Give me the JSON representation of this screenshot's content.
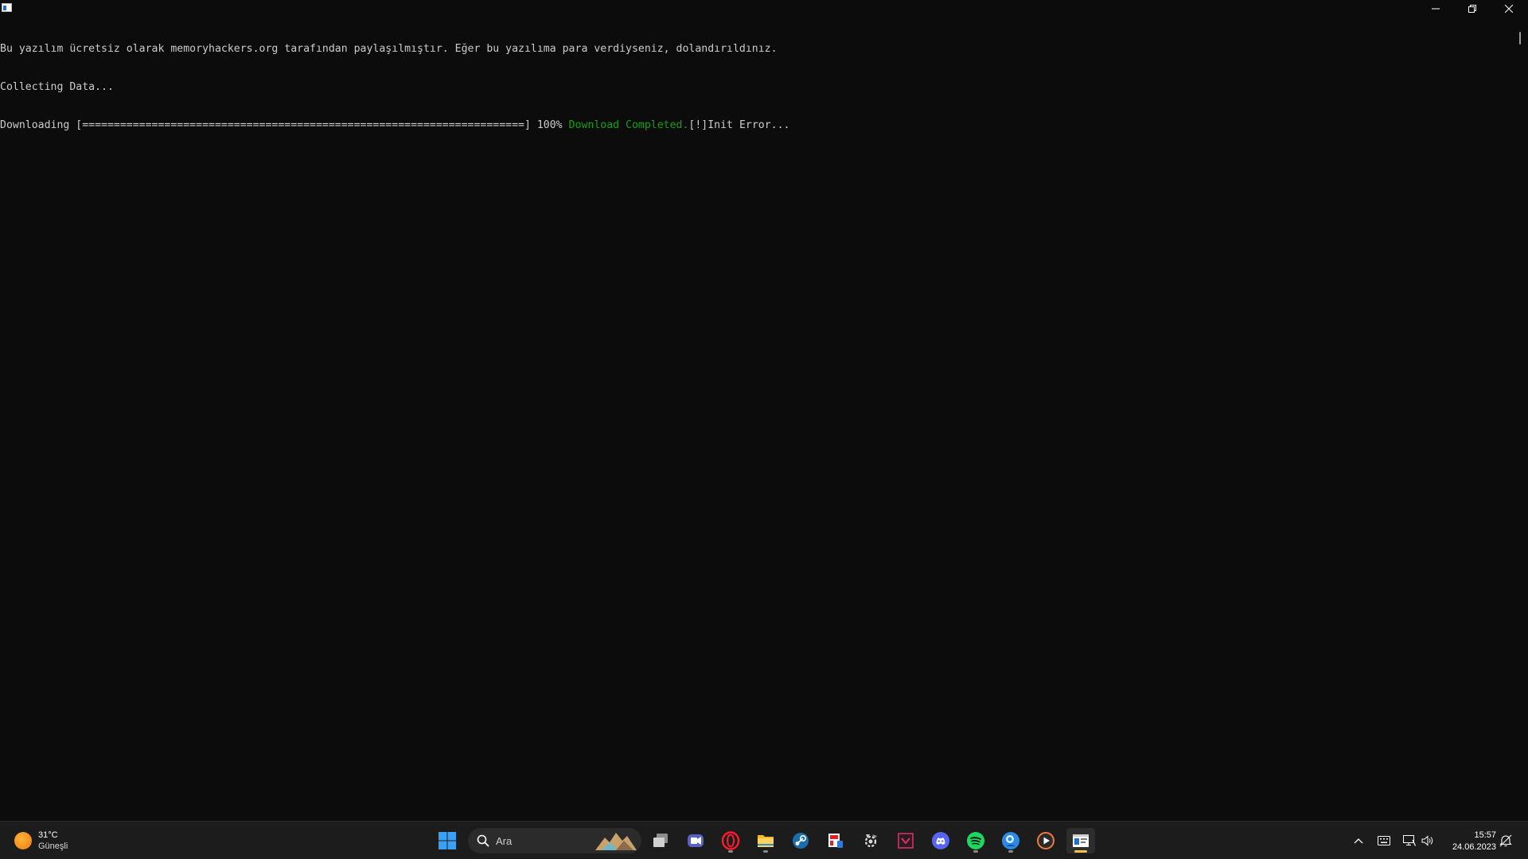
{
  "console": {
    "line1": "Bu yazılım ücretsiz olarak memoryhackers.org tarafından paylaşılmıştır. Eğer bu yazılıma para verdiyseniz, dolandırıldınız.",
    "line2": "Collecting Data...",
    "line3_prefix": "Downloading [======================================================================] 100% ",
    "line3_success": "Download Completed.",
    "line3_error": "[!]Init Error..."
  },
  "progress": {
    "percent": 100
  },
  "weather": {
    "temperature": "31°C",
    "condition": "Güneşli"
  },
  "search": {
    "placeholder": "Ara"
  },
  "taskbar_apps": [
    {
      "name": "start",
      "icon": "windows-logo-icon"
    },
    {
      "name": "task-view",
      "icon": "task-view-icon"
    },
    {
      "name": "teams",
      "icon": "teams-icon"
    },
    {
      "name": "opera",
      "icon": "opera-icon"
    },
    {
      "name": "file-explorer",
      "icon": "folder-icon"
    },
    {
      "name": "steam",
      "icon": "steam-icon"
    },
    {
      "name": "app-red",
      "icon": "app-red-icon"
    },
    {
      "name": "app-gear",
      "icon": "gear-app-icon"
    },
    {
      "name": "app-pink",
      "icon": "pink-app-icon"
    },
    {
      "name": "discord",
      "icon": "discord-icon"
    },
    {
      "name": "spotify",
      "icon": "spotify-icon"
    },
    {
      "name": "app-blue",
      "icon": "blue-app-icon"
    },
    {
      "name": "media-player",
      "icon": "play-icon"
    },
    {
      "name": "terminal",
      "icon": "terminal-icon"
    }
  ],
  "clock": {
    "time": "15:57",
    "date": "24.06.2023"
  },
  "colors": {
    "console_bg": "#0c0c0c",
    "console_text": "#cccccc",
    "success_green": "#13a10e",
    "taskbar_bg": "#1c1c1c"
  }
}
